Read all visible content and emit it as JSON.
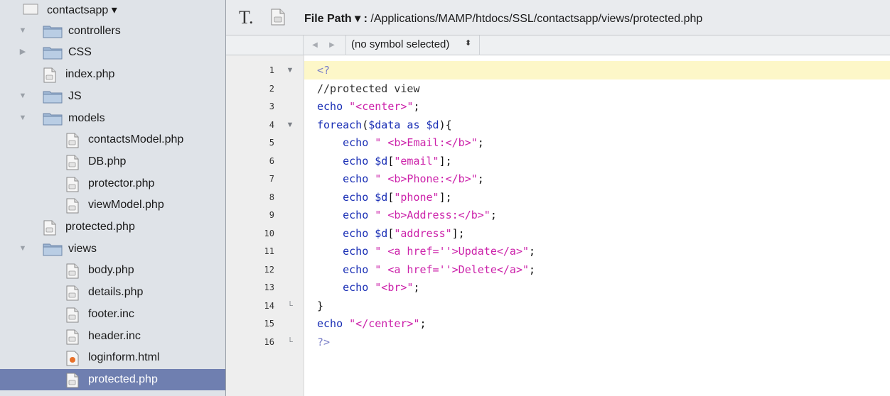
{
  "sidebar": {
    "items": [
      {
        "label": "contactsapp ▾",
        "type": "root",
        "icon": "project-icon",
        "indent": 0,
        "disclosure": "none"
      },
      {
        "label": "controllers",
        "type": "folder",
        "icon": "folder-icon",
        "indent": 0,
        "disclosure": "open"
      },
      {
        "label": "CSS",
        "type": "folder",
        "icon": "folder-icon",
        "indent": 0,
        "disclosure": "closed"
      },
      {
        "label": "index.php",
        "type": "file",
        "icon": "php-file-icon",
        "indent": 0,
        "disclosure": "none"
      },
      {
        "label": "JS",
        "type": "folder",
        "icon": "folder-icon",
        "indent": 0,
        "disclosure": "open"
      },
      {
        "label": "models",
        "type": "folder",
        "icon": "folder-icon",
        "indent": 0,
        "disclosure": "open"
      },
      {
        "label": "contactsModel.php",
        "type": "file",
        "icon": "php-file-icon",
        "indent": 1,
        "disclosure": "none"
      },
      {
        "label": "DB.php",
        "type": "file",
        "icon": "php-file-icon",
        "indent": 1,
        "disclosure": "none"
      },
      {
        "label": "protector.php",
        "type": "file",
        "icon": "php-file-icon",
        "indent": 1,
        "disclosure": "none"
      },
      {
        "label": "viewModel.php",
        "type": "file",
        "icon": "php-file-icon",
        "indent": 1,
        "disclosure": "none"
      },
      {
        "label": "protected.php",
        "type": "file",
        "icon": "php-file-icon",
        "indent": 0,
        "disclosure": "none"
      },
      {
        "label": "views",
        "type": "folder",
        "icon": "folder-icon",
        "indent": 0,
        "disclosure": "open"
      },
      {
        "label": "body.php",
        "type": "file",
        "icon": "php-file-icon",
        "indent": 1,
        "disclosure": "none"
      },
      {
        "label": "details.php",
        "type": "file",
        "icon": "php-file-icon",
        "indent": 1,
        "disclosure": "none"
      },
      {
        "label": "footer.inc",
        "type": "file",
        "icon": "php-file-icon",
        "indent": 1,
        "disclosure": "none"
      },
      {
        "label": "header.inc",
        "type": "file",
        "icon": "php-file-icon",
        "indent": 1,
        "disclosure": "none"
      },
      {
        "label": "loginform.html",
        "type": "file",
        "icon": "html-file-icon",
        "indent": 1,
        "disclosure": "none"
      },
      {
        "label": "protected.php",
        "type": "file",
        "icon": "php-file-icon",
        "indent": 1,
        "disclosure": "none",
        "selected": true
      }
    ]
  },
  "toolbar": {
    "text_tool_glyph": "T.",
    "path_label": "File Path ▾ :",
    "path_value": "/Applications/MAMP/htdocs/SSL/contactsapp/views/protected.php"
  },
  "symbol_bar": {
    "back_glyph": "◀",
    "forward_glyph": "▶",
    "selected_symbol": "(no symbol selected)",
    "stepper_glyph": "⬍"
  },
  "editor": {
    "highlighted_line": 1,
    "lines": [
      {
        "num": "1",
        "fold": "▼",
        "tokens": [
          {
            "t": "<?",
            "c": "tag"
          }
        ]
      },
      {
        "num": "2",
        "fold": "",
        "tokens": [
          {
            "t": "//protected view",
            "c": "cmt"
          }
        ]
      },
      {
        "num": "3",
        "fold": "",
        "tokens": [
          {
            "t": "echo ",
            "c": "kw"
          },
          {
            "t": "\"<center>\"",
            "c": "str"
          },
          {
            "t": ";",
            "c": "pl"
          }
        ]
      },
      {
        "num": "4",
        "fold": "▼",
        "tokens": [
          {
            "t": "foreach",
            "c": "kw"
          },
          {
            "t": "(",
            "c": "pl"
          },
          {
            "t": "$data",
            "c": "var"
          },
          {
            "t": " as ",
            "c": "kw"
          },
          {
            "t": "$d",
            "c": "var"
          },
          {
            "t": "){",
            "c": "pl"
          }
        ]
      },
      {
        "num": "5",
        "fold": "",
        "tokens": [
          {
            "t": "    echo ",
            "c": "kw"
          },
          {
            "t": "\" <b>Email:</b>\"",
            "c": "str"
          },
          {
            "t": ";",
            "c": "pl"
          }
        ]
      },
      {
        "num": "6",
        "fold": "",
        "tokens": [
          {
            "t": "    echo ",
            "c": "kw"
          },
          {
            "t": "$d",
            "c": "var"
          },
          {
            "t": "[",
            "c": "pl"
          },
          {
            "t": "\"email\"",
            "c": "str"
          },
          {
            "t": "];",
            "c": "pl"
          }
        ]
      },
      {
        "num": "7",
        "fold": "",
        "tokens": [
          {
            "t": "    echo ",
            "c": "kw"
          },
          {
            "t": "\" <b>Phone:</b>\"",
            "c": "str"
          },
          {
            "t": ";",
            "c": "pl"
          }
        ]
      },
      {
        "num": "8",
        "fold": "",
        "tokens": [
          {
            "t": "    echo ",
            "c": "kw"
          },
          {
            "t": "$d",
            "c": "var"
          },
          {
            "t": "[",
            "c": "pl"
          },
          {
            "t": "\"phone\"",
            "c": "str"
          },
          {
            "t": "];",
            "c": "pl"
          }
        ]
      },
      {
        "num": "9",
        "fold": "",
        "tokens": [
          {
            "t": "    echo ",
            "c": "kw"
          },
          {
            "t": "\" <b>Address:</b>\"",
            "c": "str"
          },
          {
            "t": ";",
            "c": "pl"
          }
        ]
      },
      {
        "num": "10",
        "fold": "",
        "tokens": [
          {
            "t": "    echo ",
            "c": "kw"
          },
          {
            "t": "$d",
            "c": "var"
          },
          {
            "t": "[",
            "c": "pl"
          },
          {
            "t": "\"address\"",
            "c": "str"
          },
          {
            "t": "];",
            "c": "pl"
          }
        ]
      },
      {
        "num": "11",
        "fold": "",
        "tokens": [
          {
            "t": "    echo ",
            "c": "kw"
          },
          {
            "t": "\" <a href=''>Update</a>\"",
            "c": "str"
          },
          {
            "t": ";",
            "c": "pl"
          }
        ]
      },
      {
        "num": "12",
        "fold": "",
        "tokens": [
          {
            "t": "    echo ",
            "c": "kw"
          },
          {
            "t": "\" <a href=''>Delete</a>\"",
            "c": "str"
          },
          {
            "t": ";",
            "c": "pl"
          }
        ]
      },
      {
        "num": "13",
        "fold": "",
        "tokens": [
          {
            "t": "    echo ",
            "c": "kw"
          },
          {
            "t": "\"<br>\"",
            "c": "str"
          },
          {
            "t": ";",
            "c": "pl"
          }
        ]
      },
      {
        "num": "14",
        "fold": "└",
        "tokens": [
          {
            "t": "}",
            "c": "pl"
          }
        ]
      },
      {
        "num": "15",
        "fold": "",
        "tokens": [
          {
            "t": "echo ",
            "c": "kw"
          },
          {
            "t": "\"</center>\"",
            "c": "str"
          },
          {
            "t": ";",
            "c": "pl"
          }
        ]
      },
      {
        "num": "16",
        "fold": "└",
        "tokens": [
          {
            "t": "?>",
            "c": "tag"
          }
        ]
      }
    ]
  },
  "colors": {
    "sidebar_bg": "#dfe3e8",
    "selection_bg": "#6f7fb0",
    "current_line_bg": "#fdf7c8",
    "keyword": "#1a2fb5",
    "string": "#cc22aa"
  }
}
